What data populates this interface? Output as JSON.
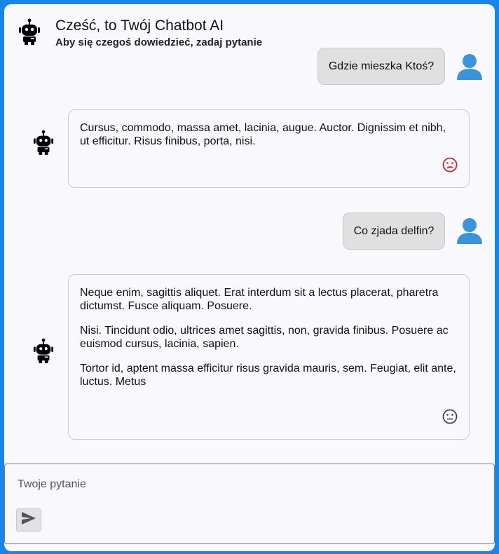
{
  "header": {
    "title": "Cześć, to Twój Chatbot AI",
    "subtitle": "Aby się czegoś dowiedzieć, zadaj pytanie",
    "bot_icon": "robot-icon"
  },
  "conversation": [
    {
      "role": "user",
      "text": "Gdzie mieszka Ktoś?"
    },
    {
      "role": "bot",
      "paragraphs": [
        "Cursus, commodo, massa amet, lacinia, augue. Auctor. Dignissim et nibh, ut efficitur. Risus finibus, porta, nisi."
      ],
      "rating_icon": "sad-face-icon"
    },
    {
      "role": "user",
      "text": "Co zjada delfin?"
    },
    {
      "role": "bot",
      "paragraphs": [
        "Neque enim, sagittis aliquet. Erat interdum sit a lectus placerat, pharetra dictumst. Fusce aliquam. Posuere.",
        "Nisi. Tincidunt odio, ultrices amet sagittis, non, gravida finibus. Posuere ac euismod cursus, lacinia, sapien.",
        "Tortor id, aptent massa efficitur risus gravida mauris, sem. Feugiat, elit ante, luctus. Metus"
      ],
      "rating_icon": "neutral-face-icon"
    }
  ],
  "input": {
    "placeholder": "Twoje pytanie",
    "value": "",
    "send_icon": "send-icon"
  },
  "colors": {
    "frame": "#1a85e8",
    "background": "#f8f8fd",
    "user_avatar": "#3a94dc",
    "user_bubble": "#e0e0e0",
    "negative_rating": "#cc2222",
    "neutral_rating": "#444444"
  }
}
